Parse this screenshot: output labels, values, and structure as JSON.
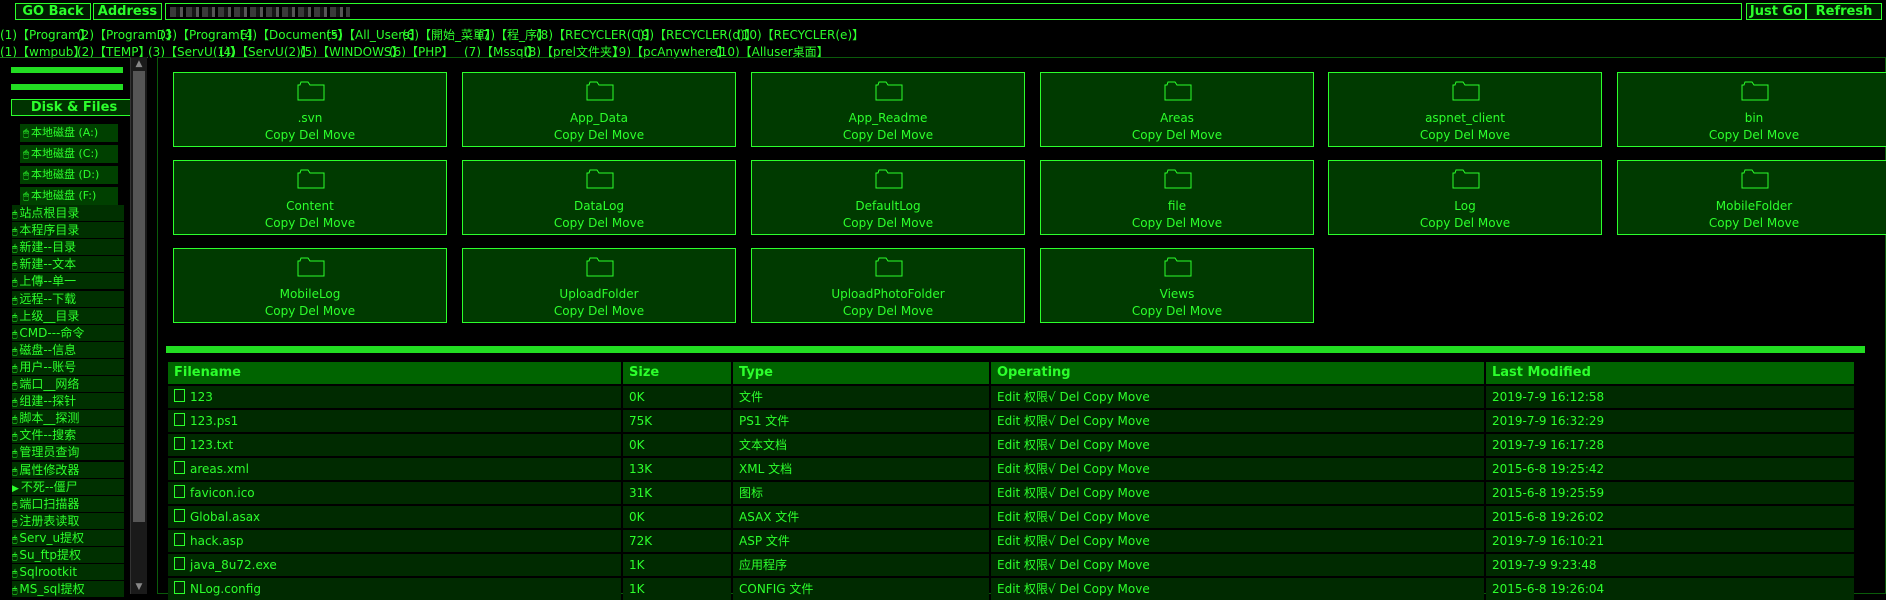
{
  "toolbar": {
    "go_back_label": "GO Back",
    "address_label": "Address",
    "address_value": "",
    "just_go_label": "Just Go",
    "refresh_label": "Refresh"
  },
  "quick_links_row1": [
    "(1)【Program】",
    "(2)【ProgramD】",
    "(3)【ProgramE】",
    "(4)【Documents】",
    "(5)【All_Users】",
    "(6)【開始_菜單】",
    "(7)【程_序】",
    "(8)【RECYCLER(C)】",
    "(9)【RECYCLER(d)】",
    "(10)【RECYCLER(e)】"
  ],
  "quick_links_row2": [
    "(1)【wmpub】",
    "(2)【TEMP】",
    "(3)【ServU(1)】",
    "(4)【ServU(2)】",
    "(5)【WINDOWS】",
    "(6)【PHP】",
    "(7)【Mssql】",
    "(8)【prel文件夹】",
    "(9)【pcAnywhere】",
    "(10)【Alluser桌面】"
  ],
  "sidebar": {
    "disk_files_label": "Disk & Files",
    "drives": [
      "本地磁盘 (A:)",
      "本地磁盘 (C:)",
      "本地磁盘 (D:)",
      "本地磁盘 (F:)"
    ],
    "tools": [
      "站点根目录",
      "本程序目录",
      "新建--目录",
      "新建--文本",
      "上傳--单一",
      "远程--下载",
      "上级__目录",
      "CMD---命令",
      "磁盘--信息",
      "用户--账号",
      "端口__网络",
      "组建--探针",
      "脚本__探测",
      "文件--搜索",
      "管理员查询",
      "属性修改器",
      "不死--僵尸",
      "端口扫描器",
      "注册表读取",
      "Serv_u提权",
      "Su_ftp提权",
      "Sqlrootkit",
      "MS_sql提权"
    ]
  },
  "folders": [
    {
      "name": ".svn",
      "ops": "Copy Del Move"
    },
    {
      "name": "App_Data",
      "ops": "Copy Del Move"
    },
    {
      "name": "App_Readme",
      "ops": "Copy Del Move"
    },
    {
      "name": "Areas",
      "ops": "Copy Del Move"
    },
    {
      "name": "aspnet_client",
      "ops": "Copy Del Move"
    },
    {
      "name": "bin",
      "ops": "Copy Del Move"
    },
    {
      "name": "Content",
      "ops": "Copy Del Move"
    },
    {
      "name": "DataLog",
      "ops": "Copy Del Move"
    },
    {
      "name": "DefaultLog",
      "ops": "Copy Del Move"
    },
    {
      "name": "file",
      "ops": "Copy Del Move"
    },
    {
      "name": "Log",
      "ops": "Copy Del Move"
    },
    {
      "name": "MobileFolder",
      "ops": "Copy Del Move"
    },
    {
      "name": "MobileLog",
      "ops": "Copy Del Move"
    },
    {
      "name": "UploadFolder",
      "ops": "Copy Del Move"
    },
    {
      "name": "UploadPhotoFolder",
      "ops": "Copy Del Move"
    },
    {
      "name": "Views",
      "ops": "Copy Del Move"
    }
  ],
  "file_table": {
    "headers": [
      "Filename",
      "Size",
      "Type",
      "Operating",
      "Last Modified"
    ],
    "rows": [
      [
        "123",
        "0K",
        "文件",
        "Edit 权限√ Del Copy Move",
        "2019-7-9 16:12:58"
      ],
      [
        "123.ps1",
        "75K",
        "PS1 文件",
        "Edit 权限√ Del Copy Move",
        "2019-7-9 16:32:29"
      ],
      [
        "123.txt",
        "0K",
        "文本文档",
        "Edit 权限√ Del Copy Move",
        "2019-7-9 16:17:28"
      ],
      [
        "areas.xml",
        "13K",
        "XML 文档",
        "Edit 权限√ Del Copy Move",
        "2015-6-8 19:25:42"
      ],
      [
        "favicon.ico",
        "31K",
        "图标",
        "Edit 权限√ Del Copy Move",
        "2015-6-8 19:25:59"
      ],
      [
        "Global.asax",
        "0K",
        "ASAX 文件",
        "Edit 权限√ Del Copy Move",
        "2015-6-8 19:26:02"
      ],
      [
        "hack.asp",
        "72K",
        "ASP 文件",
        "Edit 权限√ Del Copy Move",
        "2019-7-9 16:10:21"
      ],
      [
        "java_8u72.exe",
        "1K",
        "应用程序",
        "Edit 权限√ Del Copy Move",
        "2019-7-9 9:23:48"
      ],
      [
        "NLog.config",
        "1K",
        "CONFIG 文件",
        "Edit 权限√ Del Copy Move",
        "2015-6-8 19:26:04"
      ]
    ]
  },
  "colors": {
    "accent": "#2cff2c",
    "panel": "#003a00",
    "header": "#006400",
    "background": "#000000"
  },
  "icons": {
    "folder": "folder-icon",
    "file": "file-icon",
    "tool": "mouse-icon"
  }
}
